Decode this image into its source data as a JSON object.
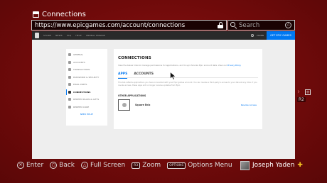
{
  "window": {
    "title": "Connections"
  },
  "address_bar": {
    "url": "https://www.epicgames.com/account/connections"
  },
  "search": {
    "placeholder": "Search"
  },
  "site": {
    "nav_links": [
      "STORE",
      "NEWS",
      "FAQ",
      "HELP",
      "UNREAL ENGINE"
    ],
    "nav_user": "YADEN",
    "nav_cta": "GET EPIC GAMES",
    "menu": [
      {
        "label": "GENERAL",
        "active": false
      },
      {
        "label": "ACCOUNTS",
        "active": false
      },
      {
        "label": "TRANSACTIONS",
        "active": false
      },
      {
        "label": "PASSWORD & SECURITY",
        "active": false
      },
      {
        "label": "EMAIL PREFS",
        "active": false
      },
      {
        "label": "CONNECTIONS",
        "active": true
      },
      {
        "label": "REDEEM PLANS & GIFTS",
        "active": false
      },
      {
        "label": "REDEEM CODE",
        "active": false
      }
    ],
    "need_help": "NEED HELP?",
    "card": {
      "title": "CONNECTIONS",
      "desc": "View the below links to manage permissions for applications, and to synchronize Epic account data. View our",
      "desc_link": "Privacy Policy",
      "tabs": [
        "APPS",
        "ACCOUNTS"
      ],
      "active_tab": 0,
      "para": "This tab reflects applications you have connected with your Epic games account. You can revoke a third-party’s access to your data at any time. If you revoke access, these apps will no longer receive updates from Epic.",
      "section_label": "OTHER APPLICATIONS",
      "app_name": "Square Enix",
      "revoke_label": "Revoke Access"
    }
  },
  "overlay": {
    "plus": "+",
    "chevron": "›",
    "r2": "R2"
  },
  "hints": [
    {
      "glyph": "✕",
      "key": "",
      "label": "Enter"
    },
    {
      "glyph": "○",
      "key": "",
      "label": "Back"
    },
    {
      "glyph": "△",
      "key": "",
      "label": "Full Screen"
    },
    {
      "glyph": "",
      "key": "R3",
      "label": "Zoom"
    },
    {
      "glyph": "",
      "key": "OPTIONS",
      "label": "Options Menu"
    }
  ],
  "user": {
    "name": "Joseph Yaden",
    "ps_plus": "✚"
  },
  "colors": {
    "accent": "#0078f2",
    "background": "#7a0c0c"
  }
}
